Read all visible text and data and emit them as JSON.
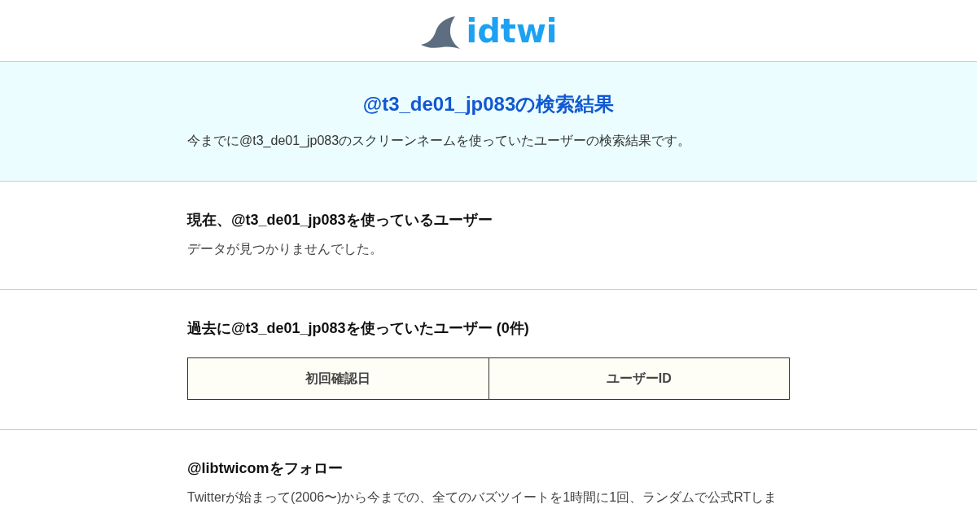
{
  "header": {
    "logo": "idtwi"
  },
  "hero": {
    "title": "@t3_de01_jp083の検索結果",
    "description": "今までに@t3_de01_jp083のスクリーンネームを使っていたユーザーの検索結果です。"
  },
  "sections": [
    {
      "kind": "message",
      "heading": "現在、@t3_de01_jp083を使っているユーザー",
      "text": "データが見つかりませんでした。"
    },
    {
      "kind": "table",
      "heading": "過去に@t3_de01_jp083を使っていたユーザー (0件)",
      "table": {
        "columns": [
          "初回確認日",
          "ユーザーID"
        ]
      }
    },
    {
      "kind": "message",
      "heading": "@libtwicomをフォロー",
      "text": "Twitterが始まって(2006〜)から今までの、全てのバズツイートを1時間に1回、ランダムで公式RTしま"
    }
  ]
}
